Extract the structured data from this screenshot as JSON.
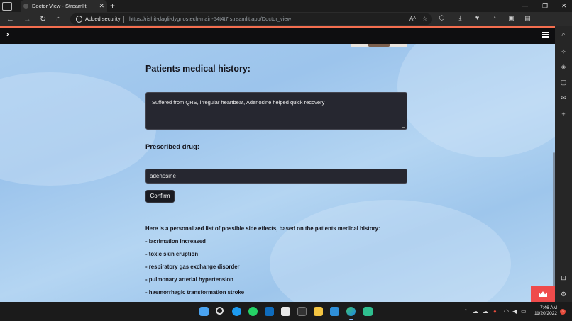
{
  "browser": {
    "tab_title": "Doctor View - Streamlit",
    "tab_close": "✕",
    "new_tab": "+",
    "security_label": "Added security",
    "url": "https://rishit-dagli-dygnostech-main-54t4t7.streamlit.app/Doctor_view",
    "read_aloud": "Aᴬ"
  },
  "page": {
    "history_heading": "Patients medical history:",
    "history_value": "Suffered from QRS, irregular heartbeat, Adenosine helped quick recovery",
    "drug_label": "Prescribed drug:",
    "drug_value": "adenosine",
    "confirm_label": "Confirm",
    "intro": "Here is a personalized list of possible side effects, based on the patients medical history:",
    "side_effects": [
      "- lacrimation increased",
      "- toxic skin eruption",
      "- respiratory gas exchange disorder",
      "- pulmonary arterial hypertension",
      "- haemorrhagic transformation stroke"
    ]
  },
  "taskbar": {
    "time": "7:46 AM",
    "date": "11/20/2022",
    "notification_count": "3"
  },
  "colors": {
    "streamlit_accent": "#f36e4f",
    "deploy_button": "#ef4b4b",
    "input_background": "#262730"
  }
}
